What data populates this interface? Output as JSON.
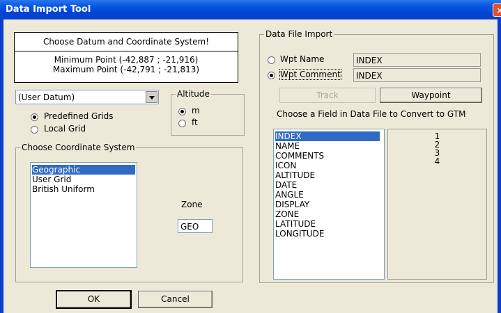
{
  "window": {
    "title": "Data Import Tool",
    "close_glyph": "×"
  },
  "info": {
    "heading": "Choose Datum and Coordinate System!",
    "min_point": "Minimum Point (-42,887 ; -21,916)",
    "max_point": "Maximum Point (-42,791 ; -21,813)"
  },
  "datum": {
    "selected": "(User Datum)"
  },
  "grid_radios": [
    {
      "label": "Predefined Grids",
      "checked": true
    },
    {
      "label": "Local Grid",
      "checked": false
    }
  ],
  "altitude": {
    "label": "Altitude",
    "options": [
      {
        "label": "m",
        "checked": true
      },
      {
        "label": "ft",
        "checked": false
      }
    ]
  },
  "coord_system": {
    "label": "Choose Coordinate System",
    "items": [
      "Geographic",
      "User Grid",
      "British Uniform"
    ],
    "selected_index": 0
  },
  "zone": {
    "label": "Zone",
    "value": "GEO"
  },
  "data_file": {
    "label": "Data File Import",
    "wpt_name": {
      "label": "Wpt Name",
      "value": "INDEX",
      "checked": false
    },
    "wpt_comment": {
      "label": "Wpt Comment",
      "value": "INDEX",
      "checked": true
    },
    "track_label": "Track",
    "waypoint_label": "Waypoint",
    "field_prompt": "Choose a Field in Data File to Convert to GTM",
    "fields": [
      "INDEX",
      "NAME",
      "COMMENTS",
      "ICON",
      "ALTITUDE",
      "DATE",
      "ANGLE",
      "DISPLAY",
      "ZONE",
      "LATITUDE",
      "LONGITUDE"
    ],
    "selected_field_index": 0,
    "numbers": [
      "1",
      "2",
      "3",
      "4"
    ]
  },
  "buttons": {
    "ok": "OK",
    "cancel": "Cancel"
  },
  "colors": {
    "titlebar": "#0a58e0",
    "selection": "#316ac5",
    "dialog_bg": "#ece9d8",
    "close": "#e2512d"
  }
}
